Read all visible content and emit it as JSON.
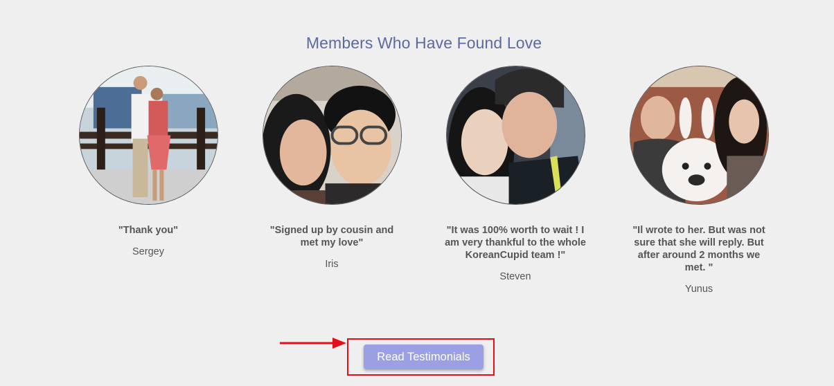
{
  "section": {
    "title": "Members Who Have Found Love"
  },
  "testimonials": [
    {
      "quote": "\"Thank you\"",
      "name": "Sergey"
    },
    {
      "quote": "\"Signed up by cousin and met my love\"",
      "name": "Iris"
    },
    {
      "quote": "\"It was 100% worth to wait ! I am very thankful to the whole KoreanCupid team !\"",
      "name": "Steven"
    },
    {
      "quote": "\"Il wrote to her. But was not sure that she will reply. But after around 2 months we met. \"",
      "name": "Yunus"
    }
  ],
  "cta": {
    "label": "Read Testimonials"
  },
  "colors": {
    "heading": "#5b6aa0",
    "button": "#9aa0e3",
    "highlight": "#e3101c",
    "background": "#efefef"
  },
  "icons": {
    "annotation_arrow": "arrow-right-icon"
  }
}
